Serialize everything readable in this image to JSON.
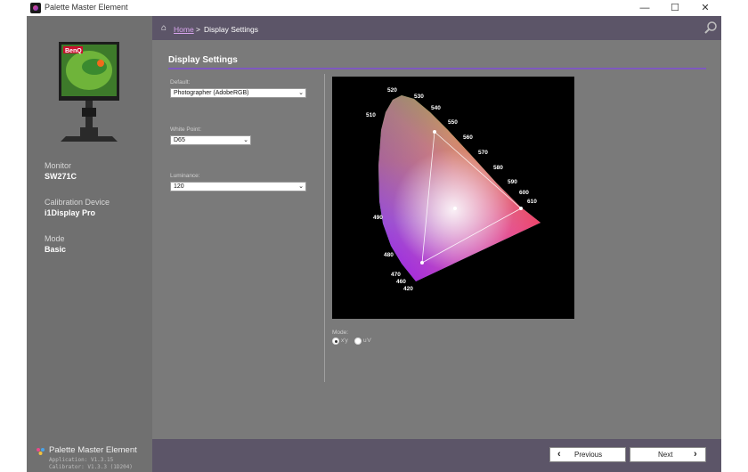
{
  "window": {
    "title": "Palette Master Element",
    "minimize": "—",
    "maximize": "☐",
    "close": "✕"
  },
  "sidebar": {
    "monitor_brand": "BenQ",
    "monitor_label": "Monitor",
    "monitor_value": "SW271C",
    "device_label": "Calibration Device",
    "device_value": "i1Display Pro",
    "mode_label": "Mode",
    "mode_value": "Basic",
    "brand_name": "Palette Master Element",
    "application_version": "Application: V1.3.15",
    "calibrator_version": "Calibrator: V1.3.3 (1D204)"
  },
  "header": {
    "home": "Home",
    "separator": ">",
    "current": "Display Settings"
  },
  "main": {
    "title": "Display Settings",
    "default_label": "Default:",
    "default_value": "Photographer (AdobeRGB)",
    "white_point_label": "White Point:",
    "white_point_value": "D65",
    "luminance_label": "Luminance:",
    "luminance_value": "120",
    "mode_label": "Mode:",
    "mode_options": [
      "x'y",
      "u'v'"
    ],
    "mode_selected": "x'y"
  },
  "cie_chart": {
    "wavelength_labels": [
      "520",
      "530",
      "540",
      "510",
      "550",
      "560",
      "570",
      "580",
      "590",
      "600",
      "610",
      "490",
      "480",
      "470",
      "460",
      "420"
    ],
    "gamut": "AdobeRGB",
    "white_point": "D65"
  },
  "footer": {
    "previous": "Previous",
    "next": "Next"
  },
  "colors": {
    "frame": "#7a7a7a",
    "header": "#5c5568",
    "accent": "#7e58c0",
    "link": "#d9a5ee"
  }
}
